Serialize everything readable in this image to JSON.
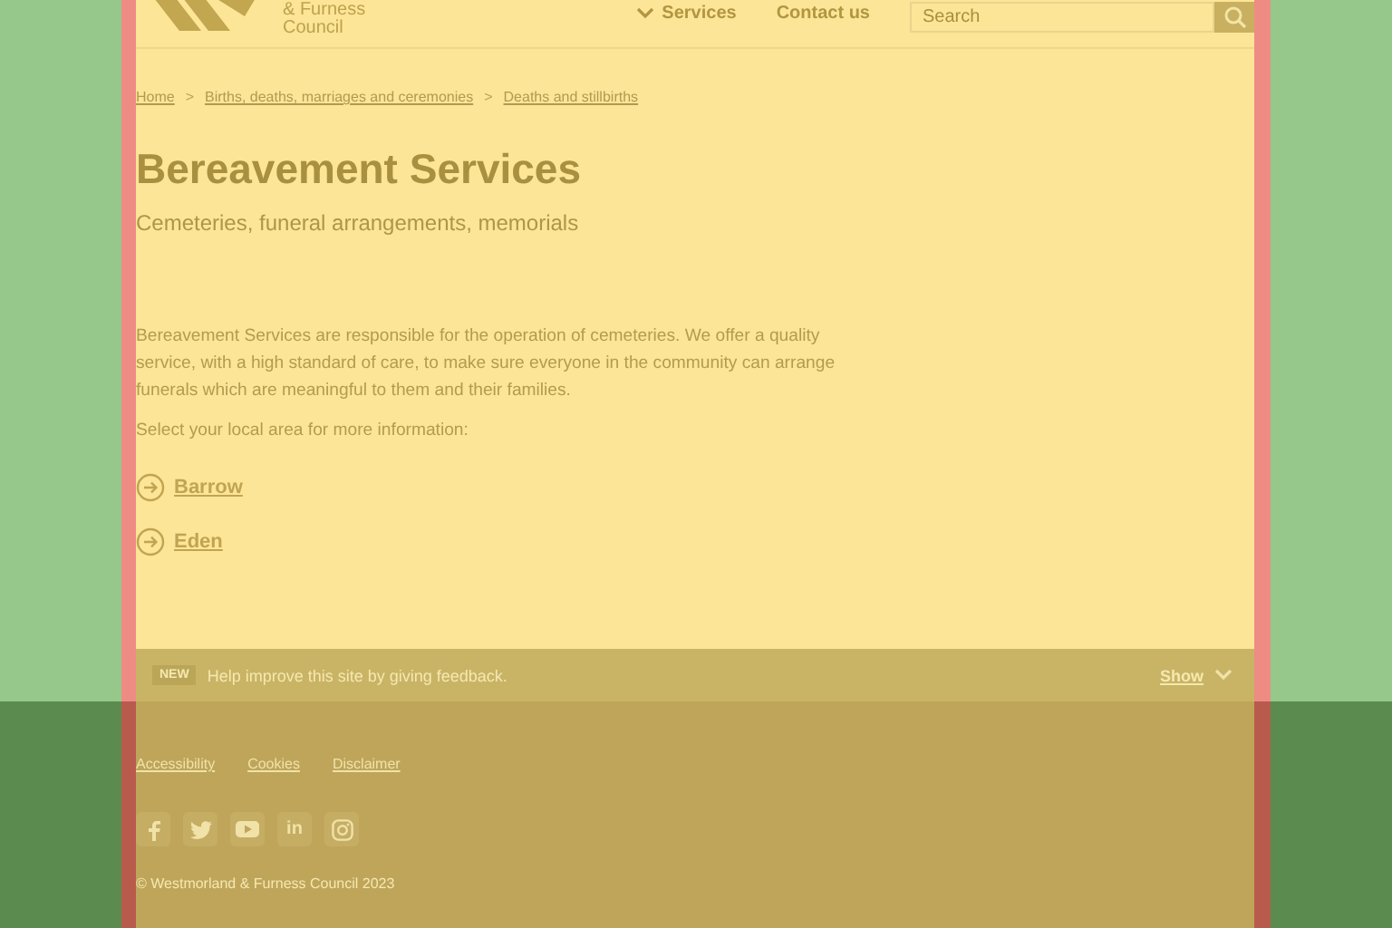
{
  "header": {
    "logo_lines": [
      "& Furness",
      "Council"
    ],
    "nav": [
      {
        "label": "Services",
        "kind": "dropdown"
      },
      {
        "label": "Contact us",
        "kind": "link"
      }
    ],
    "search": {
      "placeholder": "Search"
    }
  },
  "breadcrumbs": [
    {
      "label": "Home"
    },
    {
      "separator": ">",
      "label": "Births, deaths, marriages and ceremonies"
    },
    {
      "separator": ">",
      "label": "Deaths and stillbirths"
    }
  ],
  "title": "Bereavement Services",
  "subtitle": "Cemeteries, funeral arrangements, memorials",
  "intro": "Bereavement Services are responsible for the operation of cemeteries. We offer a quality service, with a high standard of care, to make sure everyone in the community can arrange funerals which are meaningful to them and their families.",
  "prompt": "Select your local area for more information:",
  "areas": [
    "Barrow",
    "Eden"
  ],
  "feedback": {
    "badge": "NEW",
    "text": "Help improve this site by giving feedback.",
    "toggle": "Show"
  },
  "footer": {
    "links": [
      "Accessibility",
      "Cookies",
      "Disclaimer"
    ],
    "social": [
      {
        "kind": "facebook"
      },
      {
        "kind": "twitter"
      },
      {
        "kind": "youtube"
      },
      {
        "kind": "linkedin",
        "label": "in"
      },
      {
        "kind": "instagram"
      }
    ],
    "copyright": "© Westmorland & Furness Council 2023"
  }
}
